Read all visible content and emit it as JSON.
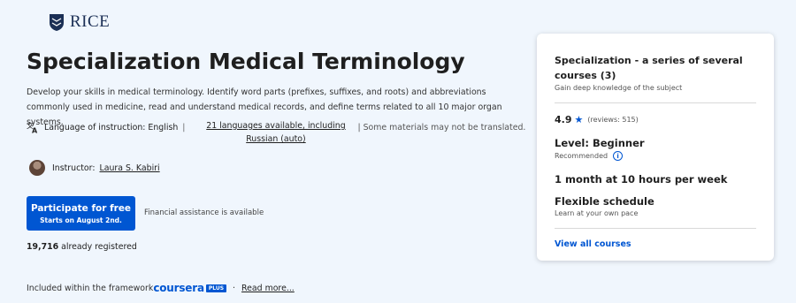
{
  "brand": {
    "logo_text": "RICE",
    "logo_icon": "shield-owl-icon",
    "colors": {
      "navy": "#1b2f55",
      "accent": "#0056d2",
      "background": "#f0f6fd"
    }
  },
  "course": {
    "title": "Specialization Medical Terminology",
    "description": "Develop your skills in medical terminology. Identify word parts (prefixes, suffixes, and roots) and abbreviations commonly used in medicine, read and understand medical records, and define terms related to all 10 major organ systems.",
    "language_label": "Language of instruction: English",
    "language_icon": "translate-icon",
    "languages_link": "21 languages available, including Russian (auto)",
    "translation_note": "| Some materials may not be translated.",
    "instructor_label": "Instructor:",
    "instructor_name": "Laura S. Kabiri"
  },
  "enroll": {
    "button_label": "Participate for free",
    "button_sub": "Starts on August 2nd.",
    "financial_aid": "Financial assistance is available",
    "registered_count": "19,716",
    "registered_label": "already registered"
  },
  "footer": {
    "included_label": "Included within the framework",
    "coursera_logo": "coursera",
    "plus_badge": "PLUS",
    "dot": "·",
    "read_more": "Read more..."
  },
  "card": {
    "heading": "Specialization - a series of several courses (3)",
    "subheading": "Gain deep knowledge of the subject",
    "rating": "4.9",
    "star_icon": "star-icon",
    "reviews": "(reviews: 515)",
    "level": "Level: Beginner",
    "recommended": "Recommended",
    "info_icon": "info-icon",
    "duration": "1 month at 10 hours per week",
    "schedule": "Flexible schedule",
    "schedule_sub": "Learn at your own pace",
    "view_all": "View all courses"
  }
}
